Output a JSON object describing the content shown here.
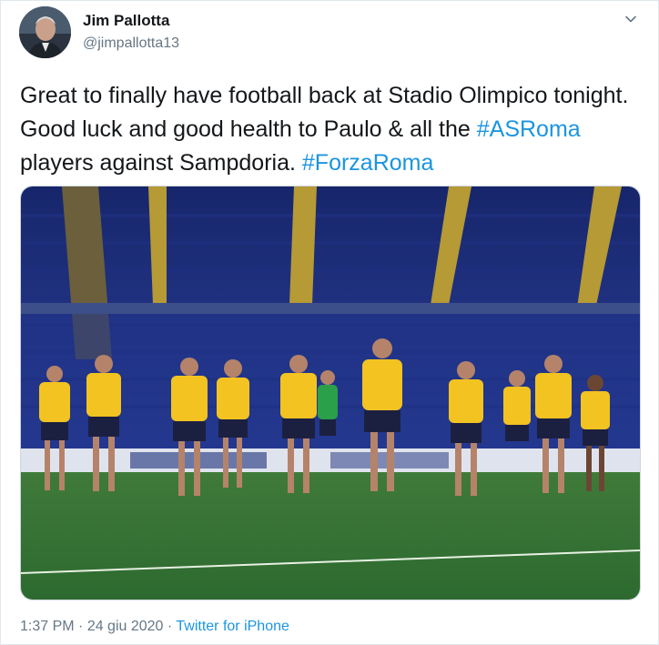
{
  "tweet": {
    "author": {
      "display_name": "Jim Pallotta",
      "handle": "@jimpallotta13",
      "avatar_icon": "profile-photo"
    },
    "menu_icon": "chevron-down-icon",
    "text_parts": {
      "p1": "Great to finally have football back at Stadio Olimpico tonight. Good luck and good health to Paulo & all the ",
      "hashtag1": "#ASRoma",
      "p2": " players against Sampdoria. ",
      "hashtag2": "#ForzaRoma"
    },
    "media": {
      "kind": "photo",
      "subject": "AS Roma players jogging on pitch at Stadio Olimpico"
    },
    "time": "1:37 PM",
    "separator": " · ",
    "date": "24 giu 2020",
    "separator2": " · ",
    "source": "Twitter for iPhone",
    "colors": {
      "link": "#1b95e0",
      "text": "#14171a",
      "secondary": "#657786",
      "border": "#e1e8ed"
    }
  }
}
